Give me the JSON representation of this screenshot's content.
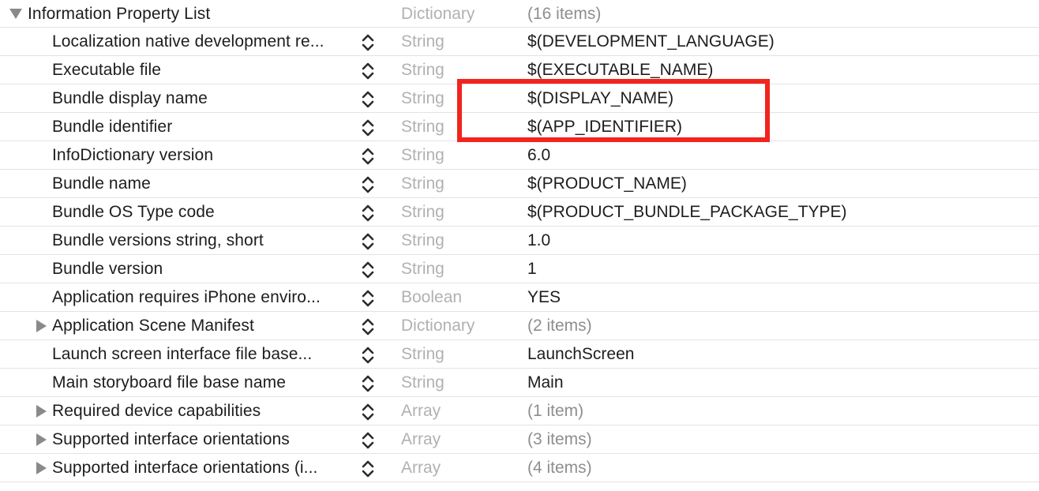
{
  "root": {
    "key": "Information Property List",
    "type": "Dictionary",
    "value": "(16 items)"
  },
  "rows": [
    {
      "key": "Localization native development re...",
      "type": "String",
      "value": "$(DEVELOPMENT_LANGUAGE)",
      "expandable": false
    },
    {
      "key": "Executable file",
      "type": "String",
      "value": "$(EXECUTABLE_NAME)",
      "expandable": false
    },
    {
      "key": "Bundle display name",
      "type": "String",
      "value": "$(DISPLAY_NAME)",
      "expandable": false
    },
    {
      "key": "Bundle identifier",
      "type": "String",
      "value": "$(APP_IDENTIFIER)",
      "expandable": false
    },
    {
      "key": "InfoDictionary version",
      "type": "String",
      "value": "6.0",
      "expandable": false
    },
    {
      "key": "Bundle name",
      "type": "String",
      "value": "$(PRODUCT_NAME)",
      "expandable": false
    },
    {
      "key": "Bundle OS Type code",
      "type": "String",
      "value": "$(PRODUCT_BUNDLE_PACKAGE_TYPE)",
      "expandable": false
    },
    {
      "key": "Bundle versions string, short",
      "type": "String",
      "value": "1.0",
      "expandable": false
    },
    {
      "key": "Bundle version",
      "type": "String",
      "value": "1",
      "expandable": false
    },
    {
      "key": "Application requires iPhone enviro...",
      "type": "Boolean",
      "value": "YES",
      "expandable": false
    },
    {
      "key": "Application Scene Manifest",
      "type": "Dictionary",
      "value": "(2 items)",
      "expandable": true
    },
    {
      "key": "Launch screen interface file base...",
      "type": "String",
      "value": "LaunchScreen",
      "expandable": false
    },
    {
      "key": "Main storyboard file base name",
      "type": "String",
      "value": "Main",
      "expandable": false
    },
    {
      "key": "Required device capabilities",
      "type": "Array",
      "value": "(1 item)",
      "expandable": true
    },
    {
      "key": "Supported interface orientations",
      "type": "Array",
      "value": "(3 items)",
      "expandable": true
    },
    {
      "key": "Supported interface orientations (i...",
      "type": "Array",
      "value": "(4 items)",
      "expandable": true
    }
  ],
  "colors": {
    "highlight": "#f3241d",
    "type_text": "#b1b1b1",
    "muted_value": "#8e8e8e",
    "row_divider": "#e3e3e3",
    "disclosure": "#8a8a8a"
  },
  "icons": {
    "root_disclosure": "disclosure-triangle-down-icon",
    "child_disclosure": "disclosure-triangle-right-icon",
    "stepper": "up-down-chevron-icon"
  }
}
